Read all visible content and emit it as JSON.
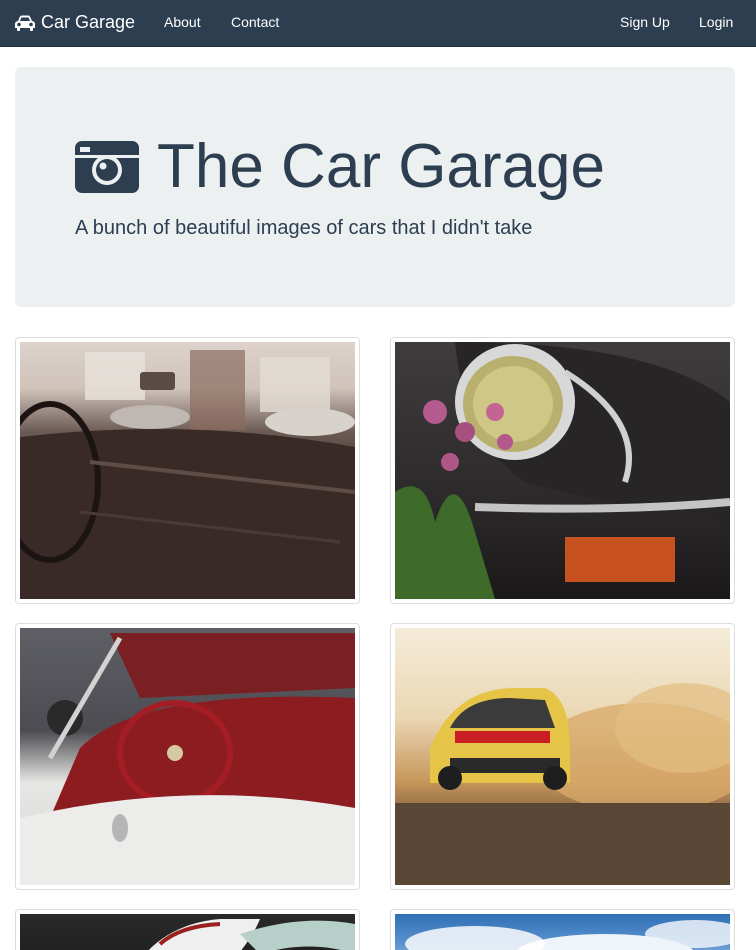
{
  "navbar": {
    "brand": "Car Garage",
    "brand_icon": "car-icon",
    "links": [
      "About",
      "Contact"
    ],
    "right_links": [
      "Sign Up",
      "Login"
    ]
  },
  "jumbotron": {
    "icon": "camera-icon",
    "title": "The Car Garage",
    "subtitle": "A bunch of beautiful images of cars that I didn't take"
  },
  "gallery": {
    "images": [
      "car-interior-photo",
      "headlight-flowers-photo",
      "red-convertible-photo",
      "rally-car-photo",
      "car-photo",
      "sky-car-photo"
    ]
  },
  "colors": {
    "navbar": "#2c3e50",
    "jumbotron_bg": "#ecf0f1",
    "text": "#2c3e50"
  }
}
